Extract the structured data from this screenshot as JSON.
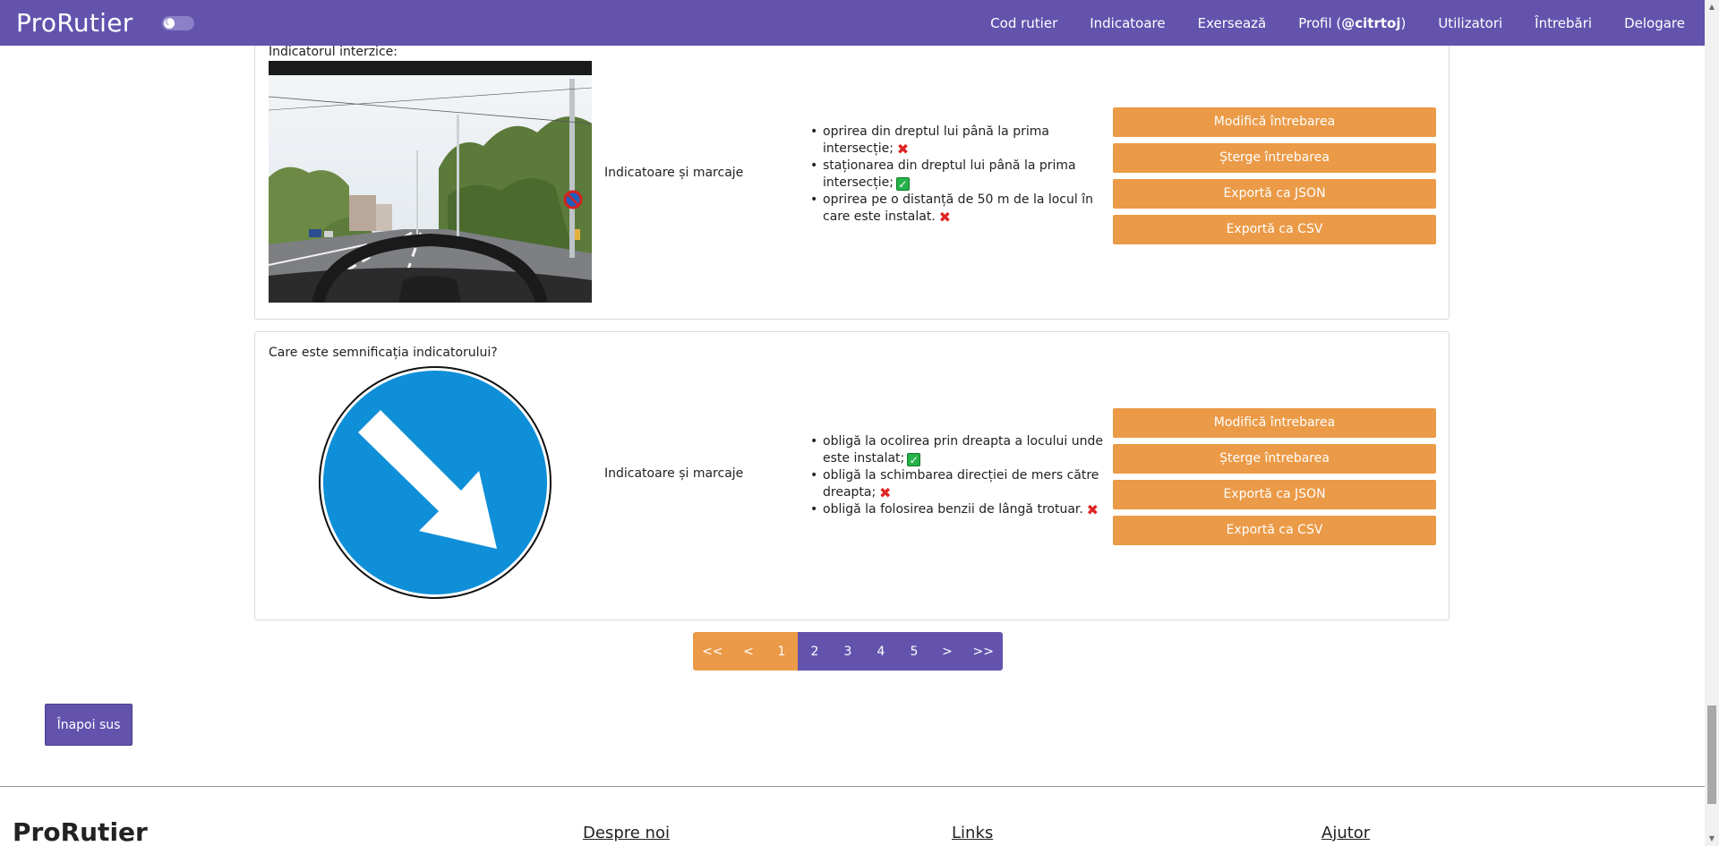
{
  "navbar": {
    "brand": "ProRutier",
    "theme_toggle_icon": "moon-icon",
    "links": {
      "cod_rutier": "Cod rutier",
      "indicatoare": "Indicatoare",
      "exerseaza": "Exersează",
      "profil_prefix": "Profil (",
      "profil_user": "@citrtoj",
      "profil_suffix": ")",
      "utilizatori": "Utilizatori",
      "intrebari": "Întrebări",
      "delogare": "Delogare"
    }
  },
  "colors": {
    "primary": "#6353ad",
    "accent": "#eb9a47",
    "sign_blue": "#0e8fd8"
  },
  "questions": [
    {
      "title": "Indicatorul interzice:",
      "category": "Indicatoare și marcaje",
      "media_icon": "street-photo-with-no-parking-sign",
      "answers": [
        {
          "text": "oprirea din dreptul lui până la prima intersecție;",
          "correct": false
        },
        {
          "text": "staționarea din dreptul lui până la prima intersecție;",
          "correct": true
        },
        {
          "text": "oprirea pe o distanță de 50 m de la locul în care este instalat.",
          "correct": false
        }
      ],
      "actions": {
        "edit": "Modifică întrebarea",
        "delete": "Șterge întrebarea",
        "export_json": "Exportă ca JSON",
        "export_csv": "Exportă ca CSV"
      }
    },
    {
      "title": "Care este semnificația indicatorului?",
      "category": "Indicatoare și marcaje",
      "media_icon": "keep-right-sign-icon",
      "answers": [
        {
          "text": "obligă la ocolirea prin dreapta a locului unde este instalat;",
          "correct": true
        },
        {
          "text": "obligă la schimbarea direcției de mers către dreapta;",
          "correct": false
        },
        {
          "text": "obligă la folosirea benzii de lângă trotuar.",
          "correct": false
        }
      ],
      "actions": {
        "edit": "Modifică întrebarea",
        "delete": "Șterge întrebarea",
        "export_json": "Exportă ca JSON",
        "export_csv": "Exportă ca CSV"
      }
    }
  ],
  "pagination": {
    "first": "<<",
    "prev": "<",
    "pages": [
      "1",
      "2",
      "3",
      "4",
      "5"
    ],
    "current": "1",
    "next": ">",
    "last": ">>"
  },
  "back_to_top": "Înapoi sus",
  "footer": {
    "brand": "ProRutier",
    "links": [
      "Despre noi",
      "Links",
      "Ajutor"
    ]
  }
}
